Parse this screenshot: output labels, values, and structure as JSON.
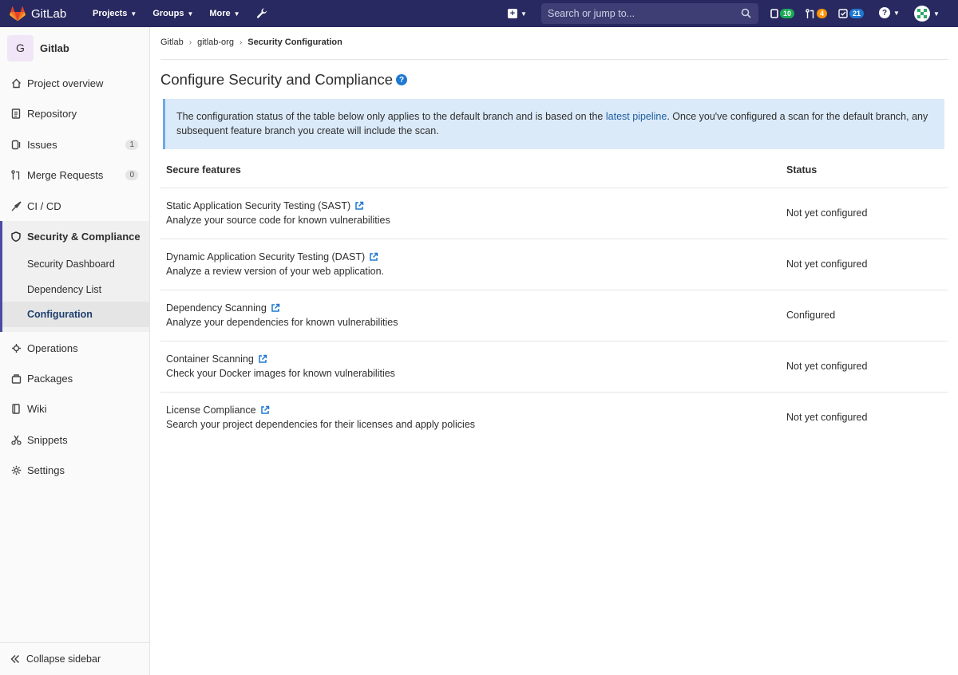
{
  "navbar": {
    "brand": "GitLab",
    "menu": [
      "Projects",
      "Groups",
      "More"
    ],
    "search_placeholder": "Search or jump to...",
    "issues_count": "10",
    "mr_count": "4",
    "todo_count": "21",
    "colors": {
      "bg": "#292961",
      "issues": "#1aaa55",
      "mr": "#fc9403",
      "todo": "#1f78d1"
    }
  },
  "sidebar": {
    "project_initial": "G",
    "project_name": "Gitlab",
    "items": [
      {
        "label": "Project overview",
        "icon": "home-icon"
      },
      {
        "label": "Repository",
        "icon": "doc-icon"
      },
      {
        "label": "Issues",
        "icon": "issues-icon",
        "count": "1"
      },
      {
        "label": "Merge Requests",
        "icon": "merge-request-icon",
        "count": "0"
      },
      {
        "label": "CI / CD",
        "icon": "rocket-icon"
      },
      {
        "label": "Security & Compliance",
        "icon": "shield-icon"
      },
      {
        "label": "Operations",
        "icon": "cloud-gear-icon"
      },
      {
        "label": "Packages",
        "icon": "package-icon"
      },
      {
        "label": "Wiki",
        "icon": "book-icon"
      },
      {
        "label": "Snippets",
        "icon": "scissors-icon"
      },
      {
        "label": "Settings",
        "icon": "settings-icon"
      }
    ],
    "sub_items": [
      "Security Dashboard",
      "Dependency List",
      "Configuration"
    ],
    "collapse_label": "Collapse sidebar"
  },
  "breadcrumb": [
    "Gitlab",
    "gitlab-org",
    "Security Configuration"
  ],
  "page": {
    "title": "Configure Security and Compliance",
    "alert_before": "The configuration status of the table below only applies to the default branch and is based on the ",
    "alert_link": "latest pipeline",
    "alert_after": ". Once you've configured a scan for the default branch, any subsequent feature branch you create will include the scan.",
    "col_features": "Secure features",
    "col_status": "Status",
    "rows": [
      {
        "name": "Static Application Security Testing (SAST)",
        "desc": "Analyze your source code for known vulnerabilities",
        "status": "Not yet configured"
      },
      {
        "name": "Dynamic Application Security Testing (DAST)",
        "desc": "Analyze a review version of your web application.",
        "status": "Not yet configured"
      },
      {
        "name": "Dependency Scanning",
        "desc": "Analyze your dependencies for known vulnerabilities",
        "status": "Configured"
      },
      {
        "name": "Container Scanning",
        "desc": "Check your Docker images for known vulnerabilities",
        "status": "Not yet configured"
      },
      {
        "name": "License Compliance",
        "desc": "Search your project dependencies for their licenses and apply policies",
        "status": "Not yet configured"
      }
    ]
  }
}
